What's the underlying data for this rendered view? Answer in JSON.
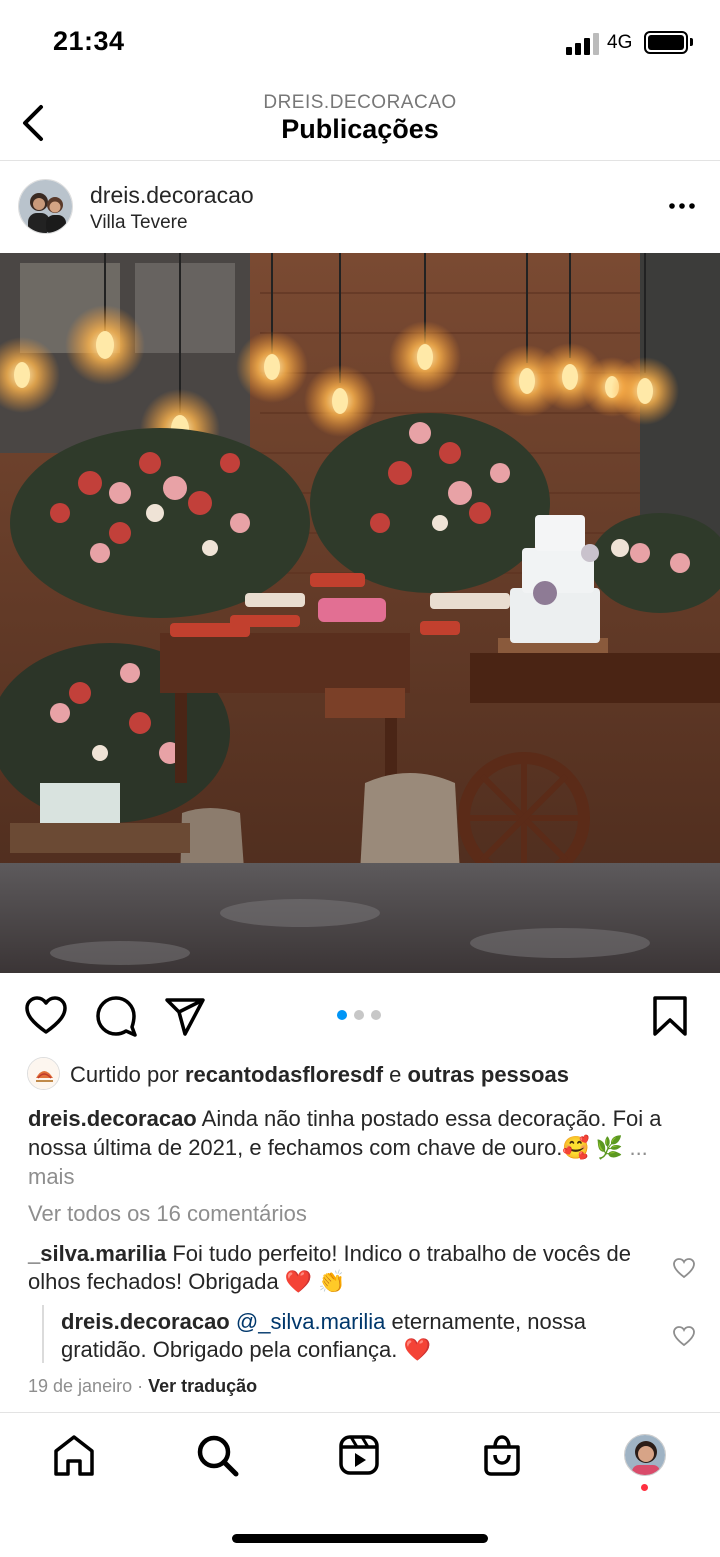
{
  "status_bar": {
    "time": "21:34",
    "network": "4G"
  },
  "header": {
    "account": "DREIS.DECORACAO",
    "title": "Publicações"
  },
  "post": {
    "username": "dreis.decoracao",
    "location": "Villa Tevere",
    "carousel": {
      "count": 3,
      "active": 1
    },
    "likes": {
      "prefix": "Curtido por",
      "user": "recantodasfloresdf",
      "joiner": "e",
      "others": "outras pessoas"
    },
    "caption": {
      "user": "dreis.decoracao",
      "text": "Ainda não tinha postado essa decoração. Foi a nossa última de 2021, e fechamos com chave de ouro.🥰 🌿",
      "more": "... mais"
    },
    "view_comments": "Ver todos os 16 comentários",
    "comment": {
      "user": "_silva.marilia",
      "text": "Foi tudo perfeito! Indico o trabalho de vocês de olhos fechados! Obrigada ❤️ 👏"
    },
    "reply": {
      "user": "dreis.decoracao",
      "mention": "@_silva.marilia",
      "text": "eternamente, nossa gratidão. Obrigado pela confiança. ❤️"
    },
    "date": "19 de janeiro",
    "separator": "·",
    "translate": "Ver tradução"
  },
  "tabbar": {
    "items": [
      "home-icon",
      "search-icon",
      "reels-icon",
      "shop-icon",
      "profile-avatar"
    ]
  },
  "colors": {
    "accent_blue": "#0095f6",
    "mention": "#00376b",
    "muted": "#8e8e8e",
    "notify": "#ff3040"
  }
}
